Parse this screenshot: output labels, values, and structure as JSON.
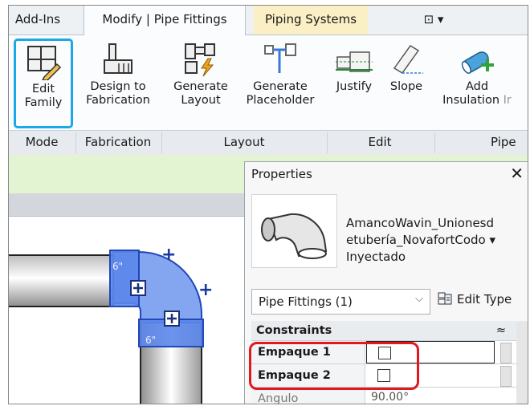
{
  "tabs": {
    "addins": "Add-Ins",
    "modify": "Modify | Pipe Fittings",
    "piping": "Piping Systems",
    "more": "⊡ ▾"
  },
  "ribbon": {
    "edit_family": [
      "Edit",
      "Family"
    ],
    "design_fab": [
      "Design to",
      "Fabrication"
    ],
    "gen_layout": [
      "Generate",
      "Layout"
    ],
    "gen_placeholder": [
      "Generate",
      "Placeholder"
    ],
    "justify": "Justify",
    "slope": "Slope",
    "add_insulation": [
      "Add",
      "Insulation"
    ],
    "insulation_cut": "Ir"
  },
  "panels": {
    "mode": "Mode",
    "fabrication": "Fabrication",
    "layout": "Layout",
    "edit": "Edit",
    "pipe": "Pipe"
  },
  "canvas": {
    "size_label_1": "6\"",
    "size_label_2": "6\"",
    "plus": "+"
  },
  "properties": {
    "title": "Properties",
    "close": "✕",
    "type_name": [
      "AmancoWavin_Unionesd",
      "etubería_NovafortCodo",
      "Inyectado"
    ],
    "type_dropdown": "▾",
    "filter": "Pipe Fittings (1)",
    "filter_chev": "⌵",
    "edit_type": "Edit Type",
    "section": "Constraints",
    "section_caret": "≈",
    "rows": [
      {
        "name": "Empaque 1",
        "checked": false
      },
      {
        "name": "Empaque 2",
        "checked": false
      },
      {
        "name": "Angulo",
        "value": "90.00°"
      }
    ]
  },
  "colors": {
    "selection_border": "#1aa8e6",
    "highlight": "#e0191f",
    "fitting_blue": "#3b6fe0",
    "context_tab": "#fbf0c5",
    "option_bar": "#e3f4d2"
  }
}
